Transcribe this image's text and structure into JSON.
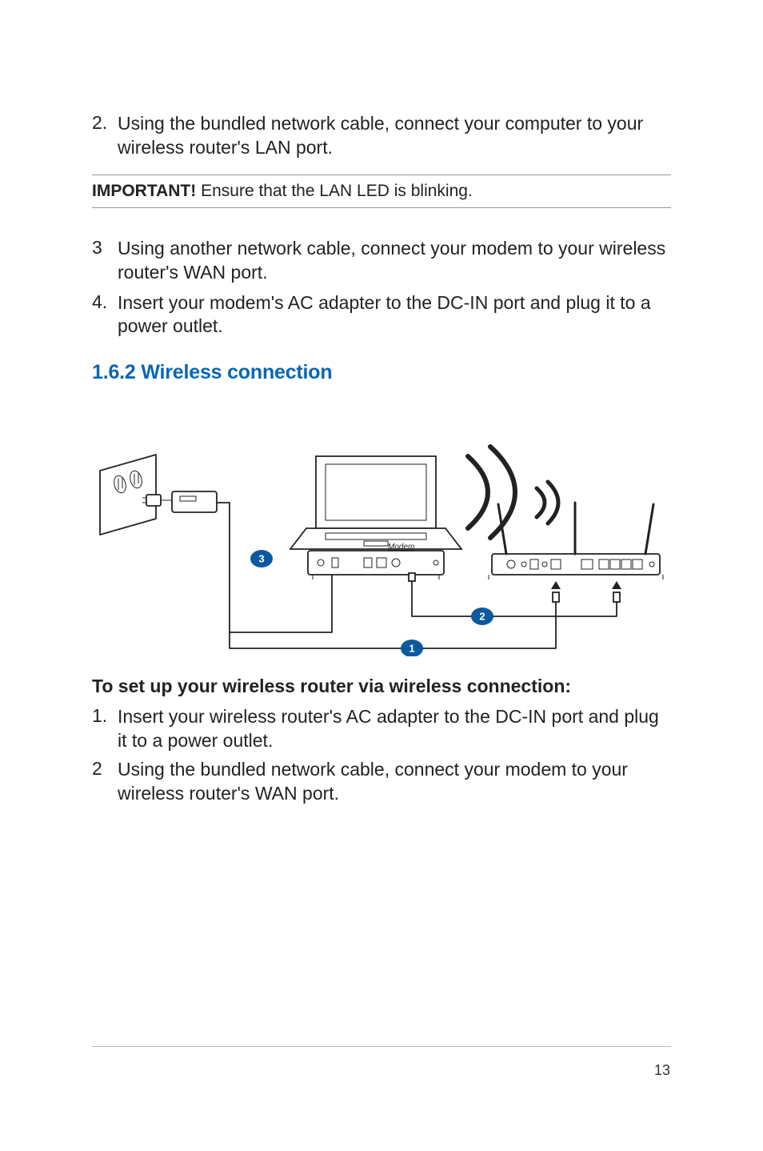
{
  "steps_top": [
    {
      "num": "2.",
      "text": "Using the bundled network cable, connect your computer to your wireless router's LAN port."
    }
  ],
  "callout": {
    "label": "IMPORTANT!",
    "text": "  Ensure that the LAN LED is blinking."
  },
  "steps_mid": [
    {
      "num": "3",
      "text": "Using another network cable, connect your modem to your wireless router's WAN port."
    },
    {
      "num": "4.",
      "text": "Insert your modem's AC adapter to the DC-IN port and plug it to a power outlet."
    }
  ],
  "section_heading": "1.6.2  Wireless connection",
  "diagram": {
    "modem_label": "Modem",
    "badges": {
      "b1": "1",
      "b2": "2",
      "b3": "3"
    }
  },
  "subheading": "To set up your wireless router via wireless connection:",
  "steps_bottom": [
    {
      "num": "1.",
      "text": "Insert your wireless router's AC adapter to the DC-IN port and plug it to a power outlet."
    },
    {
      "num": "2",
      "text": "Using the bundled network cable, connect your modem to your wireless router's WAN port."
    }
  ],
  "page_number": "13"
}
